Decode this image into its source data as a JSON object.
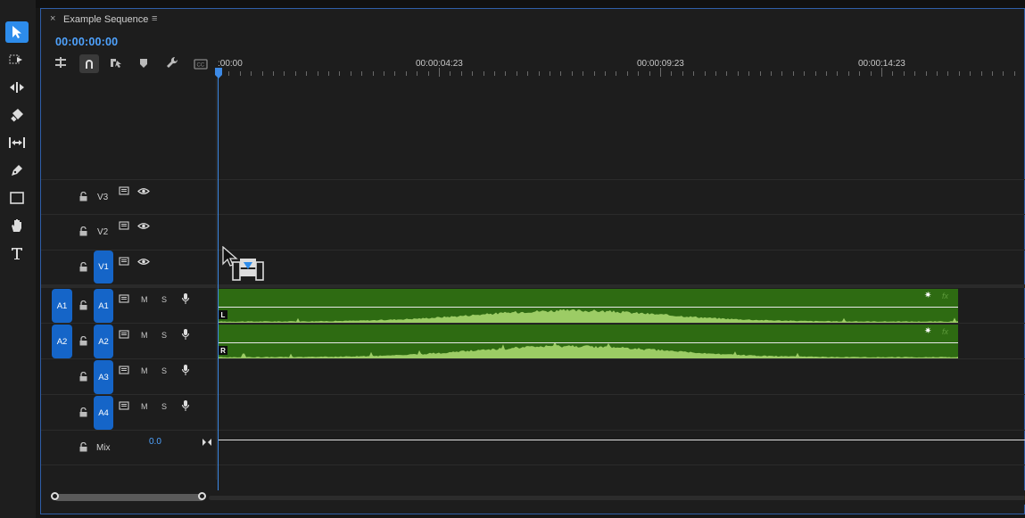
{
  "sequence": {
    "title": "Example Sequence",
    "close_glyph": "×",
    "menu_glyph": "≡",
    "timecode": "00:00:00:00"
  },
  "ruler": {
    "labels": [
      ":00:00",
      "00:00:04:23",
      "00:00:09:23",
      "00:00:14:23"
    ]
  },
  "tools": [
    "selection-tool",
    "track-select-forward-tool",
    "ripple-edit-tool",
    "razor-tool",
    "slip-tool",
    "pen-tool",
    "rectangle-tool",
    "hand-tool",
    "type-tool"
  ],
  "toolbar_icons": [
    "insert-sequence-as-nest-icon",
    "snap-icon",
    "linked-selection-icon",
    "add-marker-icon",
    "timeline-settings-icon",
    "captions-icon"
  ],
  "video_tracks": [
    {
      "name": "V3",
      "source": ""
    },
    {
      "name": "V2",
      "source": ""
    },
    {
      "name": "V1",
      "source": "V1"
    }
  ],
  "audio_tracks": [
    {
      "name": "A1",
      "source": "A1",
      "mute": "M",
      "solo": "S",
      "channel": "L"
    },
    {
      "name": "A2",
      "source": "A2",
      "mute": "M",
      "solo": "S",
      "channel": "R"
    },
    {
      "name": "A3",
      "source": "",
      "mute": "M",
      "solo": "S"
    },
    {
      "name": "A4",
      "source": "",
      "mute": "M",
      "solo": "S"
    }
  ],
  "mix": {
    "label": "Mix",
    "value": "0.0"
  },
  "clip_badge": "fx",
  "colors": {
    "accent": "#2d8ceb",
    "track_button": "#1565c8",
    "audio_clip": "#2e6b12",
    "waveform": "#9ccc65"
  }
}
